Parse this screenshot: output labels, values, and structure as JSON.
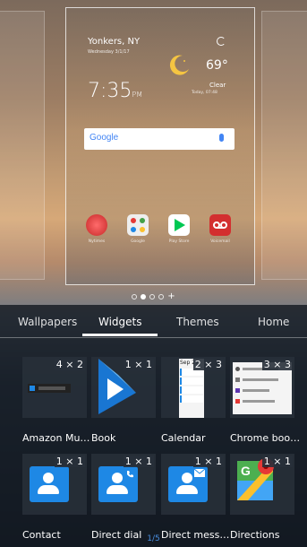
{
  "preview": {
    "location": "Yonkers, NY",
    "date": "Wednesday 3/1/17",
    "time": "7:35",
    "ampm": "PM",
    "temperature": "69°",
    "condition": "Clear",
    "condition_sub": "Today, 07:48",
    "search_logo": "Google",
    "dock_apps": [
      {
        "label": "Nytimes",
        "color": "#e53935"
      },
      {
        "label": "Google",
        "color": "#f1f1f1"
      },
      {
        "label": "Play Store",
        "color": "#ffffff"
      },
      {
        "label": "Voicemail",
        "color": "#d32f2f"
      }
    ]
  },
  "page_indicator": {
    "plus": "+"
  },
  "tabs": {
    "wallpapers": "Wallpapers",
    "widgets": "Widgets",
    "themes": "Themes",
    "home": "Home"
  },
  "widgets": [
    {
      "label": "Amazon Mu…",
      "size": "4 × 2"
    },
    {
      "label": "Book",
      "size": "1 × 1"
    },
    {
      "label": "Calendar",
      "size": "2 × 3"
    },
    {
      "label": "Chrome boo…",
      "size": "3 × 3"
    },
    {
      "label": "Contact",
      "size": "1 × 1"
    },
    {
      "label": "Direct dial",
      "size": "1 × 1"
    },
    {
      "label": "Direct mess…",
      "size": "1 × 1"
    },
    {
      "label": "Directions",
      "size": "1 × 1"
    }
  ],
  "calendar_thumb": {
    "day": "Sep 27"
  },
  "pager": "1/5"
}
